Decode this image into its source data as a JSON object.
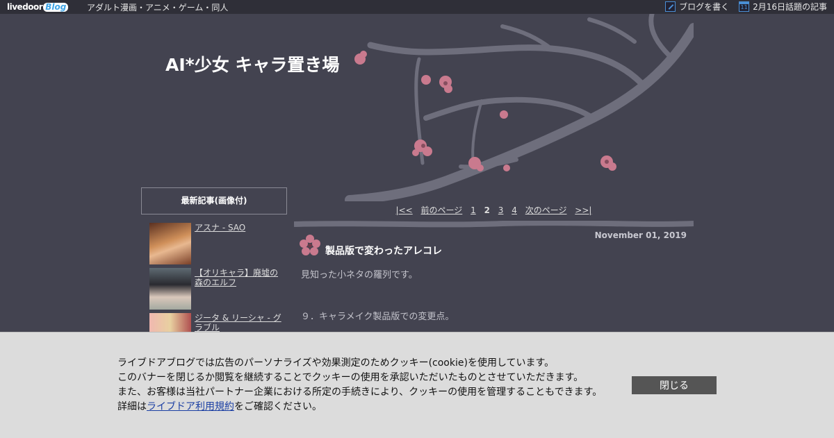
{
  "topbar": {
    "logo_livedoor": "livedoor",
    "logo_blog": "Blog",
    "category": "アダルト漫画・アニメ・ゲーム・同人",
    "write_blog": "ブログを書く",
    "hot_topics": "2月16日話題の記事",
    "calendar_day": "11"
  },
  "header": {
    "blog_title": "AI*少女 キャラ置き場"
  },
  "sidebar": {
    "heading": "最新記事(画像付)",
    "items": [
      {
        "title": "アスナ - SAO",
        "thumb_color": "#b07050"
      },
      {
        "title": "【オリキャラ】廃墟の森のエルフ",
        "thumb_color": "#6f7a80"
      },
      {
        "title": "ジータ & リーシャ - グラブル",
        "thumb_color": "#e0a0a0"
      }
    ]
  },
  "pager": {
    "first": "|<<",
    "prev": "前のページ",
    "pages": [
      "1",
      "2",
      "3",
      "4"
    ],
    "current": "2",
    "next": "次のページ",
    "last": ">>|"
  },
  "article": {
    "date": "November 01, 2019",
    "title": "製品版で変わったアレコレ",
    "intro": "見知った小ネタの羅列です。",
    "section": "９．キャラメイク製品版での変更点。"
  },
  "cookie": {
    "line1": "ライブドアブログでは広告のパーソナライズや効果測定のためクッキー(cookie)を使用しています。",
    "line2": "このバナーを閉じるか閲覧を継続することでクッキーの使用を承認いただいたものとさせていただきます。",
    "line3": "また、お客様は当社パートナー企業における所定の手続きにより、クッキーの使用を管理することもできます。",
    "line4_prefix": "詳細は",
    "line4_link": "ライブドア利用規約",
    "line4_suffix": "をご確認ください。",
    "close_label": "閉じる"
  },
  "colors": {
    "background": "#434350",
    "topbar": "#2f2f38",
    "blossom": "#c97a8e",
    "branch": "#6e6e7c"
  }
}
